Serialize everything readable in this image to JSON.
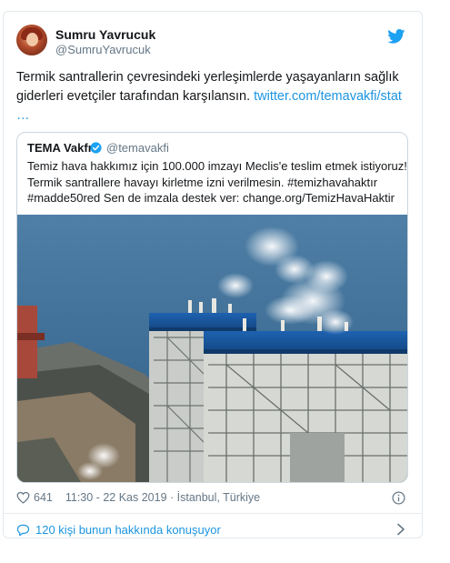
{
  "author": {
    "name": "Sumru Yavrucuk",
    "handle": "@SumruYavrucuk"
  },
  "tweet": {
    "text": "Termik santrallerin çevresindeki yerleşimlerde yaşayanların sağlık giderleri evetçiler tarafından karşılansın.",
    "link": "twitter.com/temavakfi/stat",
    "ellipsis": "…"
  },
  "quoted": {
    "name": "TEMA Vakfı",
    "handle": "@temavakfi",
    "lines": [
      "Temiz hava hakkımız için 100.000 imzayı Meclis'e teslim etmek istiyoruz!",
      "Termik santrallere havayı kirletme izni verilmesin. #temizhavahaktır",
      "#madde50red  Sen de imzala destek ver: change.org/TemizHavaHaktir"
    ]
  },
  "meta": {
    "likes": "641",
    "timestamp": "11:30 - 22 Kas 2019 · İstanbul, Türkiye"
  },
  "conversation": {
    "label": "120 kişi bunun hakkında konuşuyor"
  },
  "colors": {
    "accent": "#1b95e0",
    "muted": "#657786"
  }
}
